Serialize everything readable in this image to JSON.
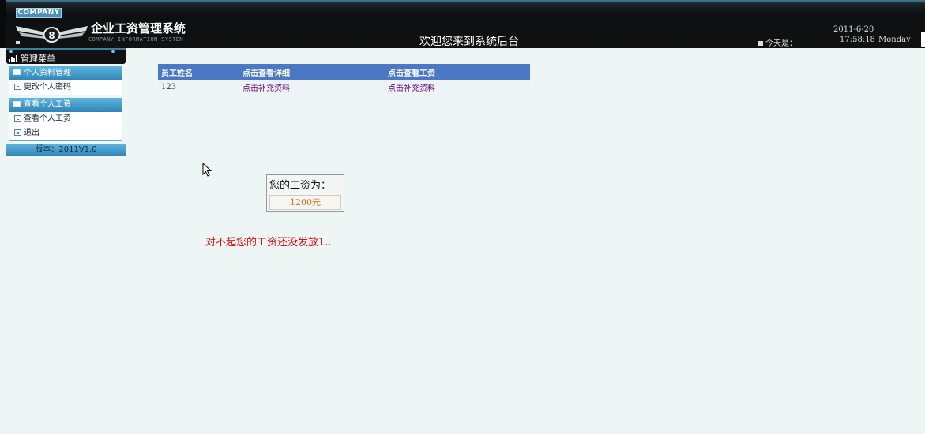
{
  "header": {
    "company_tag": "COMPANY",
    "app_title": "企业工资管理系统",
    "app_subtitle": "COMPANY INFORMATION SYSTEM",
    "welcome": "欢迎您来到系统后台",
    "today_label": "今天是：",
    "date": "2011-6-20",
    "time": "17:58:18",
    "weekday": "Monday"
  },
  "sidebar": {
    "menu_title": "管理菜单",
    "groups": [
      {
        "title": "个人资料管理",
        "items": [
          {
            "label": "更改个人密码"
          }
        ]
      },
      {
        "title": "查看个人工资",
        "items": [
          {
            "label": "查看个人工资"
          },
          {
            "label": "退出"
          }
        ]
      }
    ],
    "version": "版本：2011V1.0"
  },
  "table": {
    "headers": [
      "员工姓名",
      "点击查看详细",
      "点击查看工资"
    ],
    "rows": [
      {
        "name": "123",
        "detail_link": "点击补充资料",
        "salary_link": "点击补充资料"
      }
    ]
  },
  "salary": {
    "label": "您的工资为：",
    "value": "1200元"
  },
  "dots": "..",
  "apology": "对不起您的工资还没发放1..",
  "colors": {
    "header_bg": "#111111",
    "accent_blue": "#2f84b5",
    "table_header": "#4a78c4",
    "link": "#600080",
    "salary_value": "#e07030",
    "apology": "#dd1111"
  }
}
